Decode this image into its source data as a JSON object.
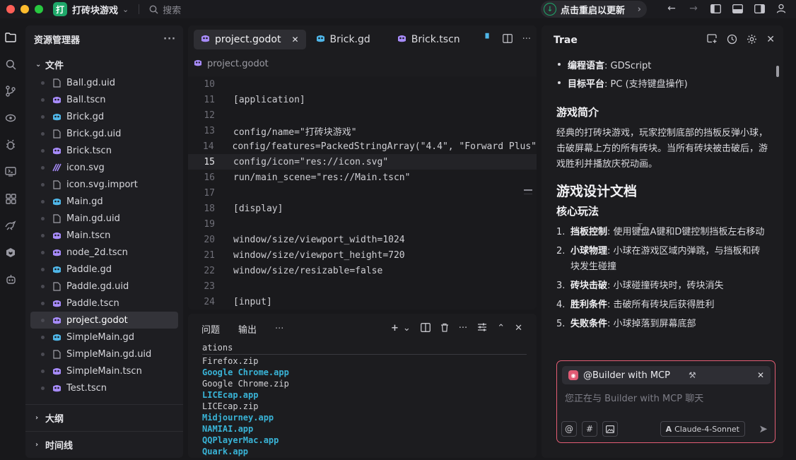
{
  "titlebar": {
    "project_badge": "打",
    "project_name": "打砖块游戏",
    "search_placeholder": "搜索",
    "restart_label": "点击重启以更新"
  },
  "explorer": {
    "title": "资源管理器",
    "files_section": "文件",
    "files": [
      {
        "name": "Ball.gd.uid",
        "type": "doc"
      },
      {
        "name": "Ball.tscn",
        "type": "scene"
      },
      {
        "name": "Brick.gd",
        "type": "gd"
      },
      {
        "name": "Brick.gd.uid",
        "type": "doc"
      },
      {
        "name": "Brick.tscn",
        "type": "scene"
      },
      {
        "name": "icon.svg",
        "type": "svg"
      },
      {
        "name": "icon.svg.import",
        "type": "doc"
      },
      {
        "name": "Main.gd",
        "type": "gd"
      },
      {
        "name": "Main.gd.uid",
        "type": "doc"
      },
      {
        "name": "Main.tscn",
        "type": "scene"
      },
      {
        "name": "node_2d.tscn",
        "type": "scene"
      },
      {
        "name": "Paddle.gd",
        "type": "gd"
      },
      {
        "name": "Paddle.gd.uid",
        "type": "doc"
      },
      {
        "name": "Paddle.tscn",
        "type": "scene"
      },
      {
        "name": "project.godot",
        "type": "godot"
      },
      {
        "name": "SimpleMain.gd",
        "type": "gd"
      },
      {
        "name": "SimpleMain.gd.uid",
        "type": "doc"
      },
      {
        "name": "SimpleMain.tscn",
        "type": "scene"
      },
      {
        "name": "Test.tscn",
        "type": "scene"
      }
    ],
    "selected_file": "project.godot",
    "outline_section": "大纲",
    "timeline_section": "时间线"
  },
  "editor": {
    "tabs": [
      {
        "label": "project.godot",
        "active": true
      },
      {
        "label": "Brick.gd",
        "active": false
      },
      {
        "label": "Brick.tscn",
        "active": false
      }
    ],
    "breadcrumb": "project.godot",
    "current_line": 15,
    "lines": [
      {
        "n": "10",
        "text": ""
      },
      {
        "n": "11",
        "text": "[application]"
      },
      {
        "n": "12",
        "text": ""
      },
      {
        "n": "13",
        "text": "config/name=\"打砖块游戏\""
      },
      {
        "n": "14",
        "text": "config/features=PackedStringArray(\"4.4\", \"Forward Plus\""
      },
      {
        "n": "15",
        "text": "config/icon=\"res://icon.svg\""
      },
      {
        "n": "16",
        "text": "run/main_scene=\"res://Main.tscn\""
      },
      {
        "n": "17",
        "text": ""
      },
      {
        "n": "18",
        "text": "[display]"
      },
      {
        "n": "19",
        "text": ""
      },
      {
        "n": "20",
        "text": "window/size/viewport_width=1024"
      },
      {
        "n": "21",
        "text": "window/size/viewport_height=720"
      },
      {
        "n": "22",
        "text": "window/size/resizable=false"
      },
      {
        "n": "23",
        "text": ""
      },
      {
        "n": "24",
        "text": "[input]"
      }
    ]
  },
  "panel": {
    "tabs": [
      "问题",
      "输出"
    ],
    "more": "···",
    "terminal_lines": [
      {
        "text": "ations",
        "dir": false
      },
      {
        "text": "Firefox.zip",
        "dir": false
      },
      {
        "text": "Google Chrome.app",
        "dir": true
      },
      {
        "text": "Google Chrome.zip",
        "dir": false
      },
      {
        "text": "LICEcap.app",
        "dir": true
      },
      {
        "text": "LICEcap.zip",
        "dir": false
      },
      {
        "text": "Midjourney.app",
        "dir": true
      },
      {
        "text": "NAMIAI.app",
        "dir": true
      },
      {
        "text": "QQPlayerMac.app",
        "dir": true
      },
      {
        "text": "Quark.app",
        "dir": true
      }
    ]
  },
  "chat": {
    "title": "Trae",
    "bullets": [
      {
        "label": "编程语言",
        "value": ": GDScript"
      },
      {
        "label": "目标平台",
        "value": ": PC (支持键盘操作)"
      }
    ],
    "h_intro": "游戏简介",
    "intro_text": "经典的打砖块游戏，玩家控制底部的挡板反弹小球，击破屏幕上方的所有砖块。当所有砖块被击破后，游戏胜利并播放庆祝动画。",
    "h_design": "游戏设计文档",
    "h_core": "核心玩法",
    "core_items": [
      {
        "n": "1.",
        "label": "挡板控制",
        "text": ": 使用键盘A键和D键控制挡板左右移动"
      },
      {
        "n": "2.",
        "label": "小球物理",
        "text": ": 小球在游戏区域内弹跳，与挡板和砖块发生碰撞"
      },
      {
        "n": "3.",
        "label": "砖块击破",
        "text": ": 小球碰撞砖块时，砖块消失"
      },
      {
        "n": "4.",
        "label": "胜利条件",
        "text": ": 击破所有砖块后获得胜利"
      },
      {
        "n": "5.",
        "label": "失败条件",
        "text": ": 小球掉落到屏幕底部"
      }
    ],
    "agent_chip": "@Builder with MCP",
    "input_placeholder": "您正在与 Builder with MCP 聊天",
    "model": "Claude-4-Sonnet"
  },
  "colors": {
    "accent_green": "#1fa86a",
    "godot_purple": "#a78bfa",
    "gd_blue": "#4fb6e8",
    "input_border": "#e45d74",
    "terminal_dir": "#39b3d6"
  }
}
